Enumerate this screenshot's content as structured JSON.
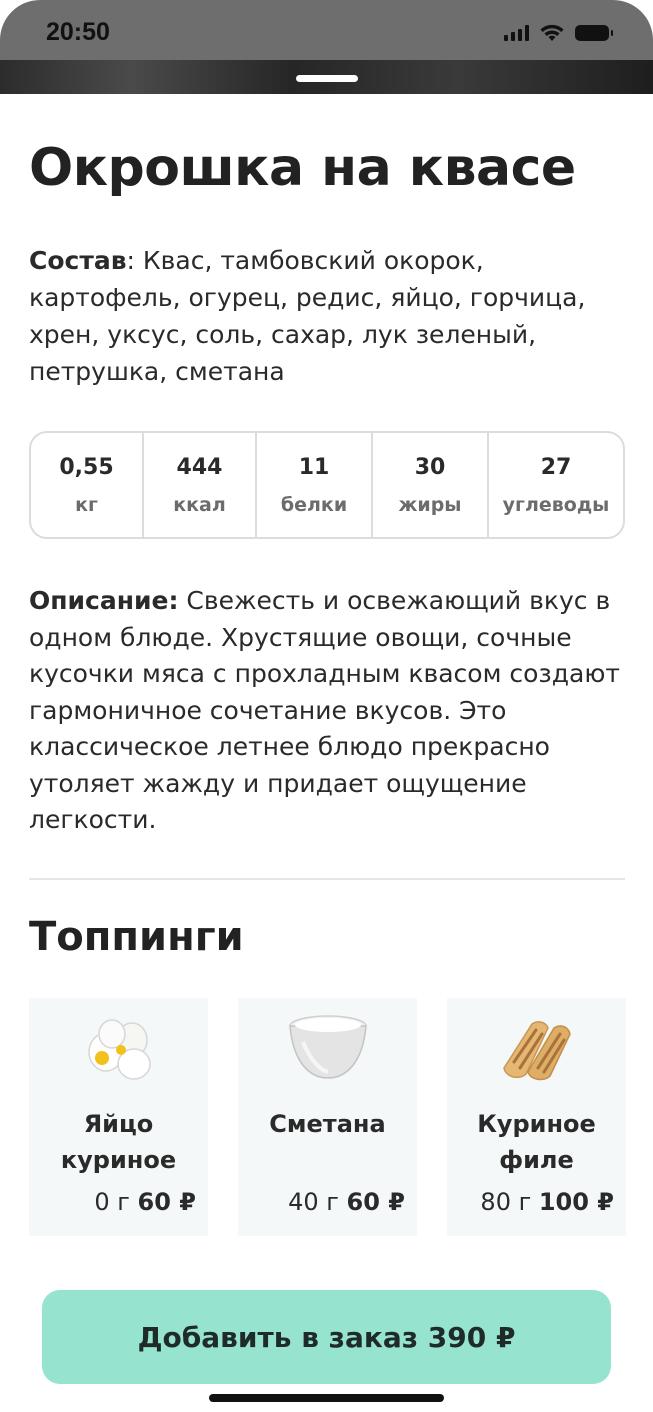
{
  "status_bar": {
    "time": "20:50"
  },
  "dish": {
    "title": "Окрошка на квасе",
    "composition_label": "Состав",
    "composition_text": ": Квас, тамбовский окорок, картофель, огурец, редис, яйцо, горчица, хрен, уксус, соль, сахар, лук зеленый, петрушка, сметана",
    "nutrition": [
      {
        "value": "0,55",
        "unit": "кг"
      },
      {
        "value": "444",
        "unit": "ккал"
      },
      {
        "value": "11",
        "unit": "белки"
      },
      {
        "value": "30",
        "unit": "жиры"
      },
      {
        "value": "27",
        "unit": "углеводы"
      }
    ],
    "description_label": "Описание:",
    "description_text": " Свежесть и освежающий вкус в одном блюде. Хрустящие овощи, сочные кусочки мяса с прохладным квасом создают гармоничное сочетание вкусов. Это классическое летнее блюдо прекрасно утоляет жажду и придает ощущение легкости."
  },
  "toppings": {
    "title": "Топпинги",
    "items": [
      {
        "name": "Яйцо куриное",
        "weight": "0 г",
        "price": "60 ₽",
        "icon": "egg-icon"
      },
      {
        "name": "Сметана",
        "weight": "40 г",
        "price": "60 ₽",
        "icon": "sour-cream-icon"
      },
      {
        "name": "Куриное филе",
        "weight": "80 г",
        "price": "100 ₽",
        "icon": "chicken-fillet-icon"
      }
    ]
  },
  "add_button": {
    "label": "Добавить в заказ 390 ₽"
  },
  "colors": {
    "accent": "#96e3cf",
    "card_bg": "#f4f8f9",
    "border": "#dcdcdc"
  }
}
